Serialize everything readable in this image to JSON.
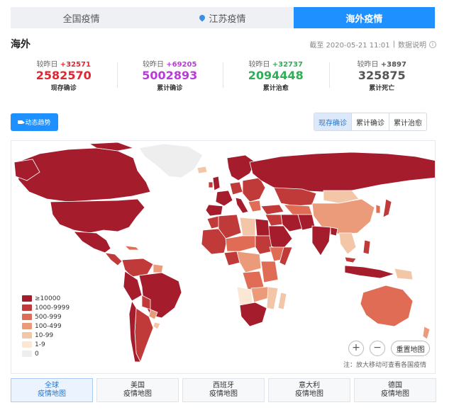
{
  "tabs": [
    {
      "label": "全国疫情"
    },
    {
      "label": "江苏疫情"
    },
    {
      "label": "海外疫情"
    }
  ],
  "header": {
    "title": "海外",
    "updated": "截至 2020-05-21 11:01",
    "separator": "|",
    "data_note": "数据说明",
    "info_icon": "info-icon"
  },
  "stats": [
    {
      "delta_label": "较昨日",
      "delta": "+32571",
      "value": "2582570",
      "label": "现存确诊",
      "color": "#e0262f"
    },
    {
      "delta_label": "较昨日",
      "delta": "+69205",
      "value": "5002893",
      "label": "累计确诊",
      "color": "#b83bd8"
    },
    {
      "delta_label": "较昨日",
      "delta": "+32737",
      "value": "2094448",
      "label": "累计治愈",
      "color": "#2fae55"
    },
    {
      "delta_label": "较昨日",
      "delta": "+3897",
      "value": "325875",
      "label": "累计死亡",
      "color": "#555555"
    }
  ],
  "trend_button": {
    "label": "动态趋势",
    "icon": "video-camera-icon"
  },
  "metric_tabs": [
    {
      "label": "现存确诊"
    },
    {
      "label": "累计确诊"
    },
    {
      "label": "累计治愈"
    }
  ],
  "legend": [
    {
      "label": "≥10000",
      "color": "#a51d2d"
    },
    {
      "label": "1000-9999",
      "color": "#c13a3a"
    },
    {
      "label": "500-999",
      "color": "#e06c55"
    },
    {
      "label": "100-499",
      "color": "#eb9b7a"
    },
    {
      "label": "10-99",
      "color": "#f4c6a8"
    },
    {
      "label": "1-9",
      "color": "#fbe7d3"
    },
    {
      "label": "0",
      "color": "#eeeeee"
    }
  ],
  "map_controls": {
    "zoom_in": "+",
    "zoom_out": "−",
    "reset": "重置地图",
    "note": "注：放大移动可查看各国疫情"
  },
  "bottom_tabs": [
    {
      "line1": "全球",
      "line2": "疫情地图"
    },
    {
      "line1": "美国",
      "line2": "疫情地图"
    },
    {
      "line1": "西班牙",
      "line2": "疫情地图"
    },
    {
      "line1": "意大利",
      "line2": "疫情地图"
    },
    {
      "line1": "德国",
      "line2": "疫情地图"
    }
  ]
}
